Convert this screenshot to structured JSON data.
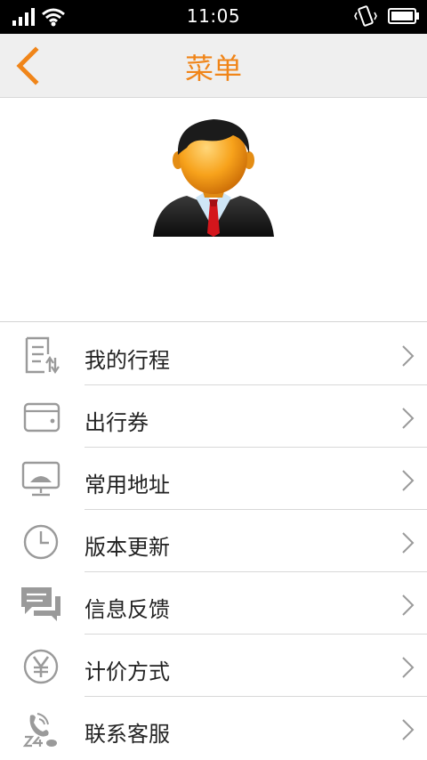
{
  "status_bar": {
    "time": "11:05"
  },
  "nav": {
    "title": "菜单"
  },
  "menu": {
    "items": [
      {
        "label": "我的行程",
        "icon": "itinerary-icon"
      },
      {
        "label": "出行券",
        "icon": "wallet-icon"
      },
      {
        "label": "常用地址",
        "icon": "address-icon"
      },
      {
        "label": "版本更新",
        "icon": "clock-icon"
      },
      {
        "label": "信息反馈",
        "icon": "feedback-icon"
      },
      {
        "label": "计价方式",
        "icon": "yen-icon"
      },
      {
        "label": "联系客服",
        "icon": "customer-service-icon"
      }
    ]
  },
  "colors": {
    "accent": "#f08519",
    "icon_gray": "#9a9a9a"
  }
}
